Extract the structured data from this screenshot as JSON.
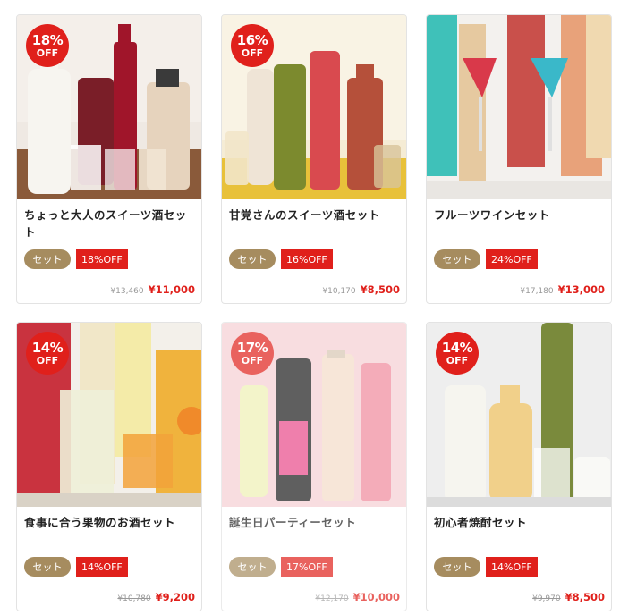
{
  "colors": {
    "sale_red": "#e0201b",
    "set_tag": "#a68c5f"
  },
  "products": [
    {
      "title": "ちょっと大人のスイーツ酒セット",
      "discount": "18%",
      "off": "OFF",
      "tag": "セット",
      "tag_off": "18%OFF",
      "old_price": "¥13,460",
      "price": "¥11,000"
    },
    {
      "title": "甘党さんのスイーツ酒セット",
      "discount": "16%",
      "off": "OFF",
      "tag": "セット",
      "tag_off": "16%OFF",
      "old_price": "¥10,170",
      "price": "¥8,500"
    },
    {
      "title": "フルーツワインセット",
      "discount": "",
      "off": "",
      "tag": "セット",
      "tag_off": "24%OFF",
      "old_price": "¥17,180",
      "price": "¥13,000"
    },
    {
      "title": "食事に合う果物のお酒セット",
      "discount": "14%",
      "off": "OFF",
      "tag": "セット",
      "tag_off": "14%OFF",
      "old_price": "¥10,780",
      "price": "¥9,200"
    },
    {
      "title": "誕生日パーティーセット",
      "discount": "17%",
      "off": "OFF",
      "tag": "セット",
      "tag_off": "17%OFF",
      "old_price": "¥12,170",
      "price": "¥10,000"
    },
    {
      "title": "初心者焼酎セット",
      "discount": "14%",
      "off": "OFF",
      "tag": "セット",
      "tag_off": "14%OFF",
      "old_price": "¥9,970",
      "price": "¥8,500"
    }
  ]
}
